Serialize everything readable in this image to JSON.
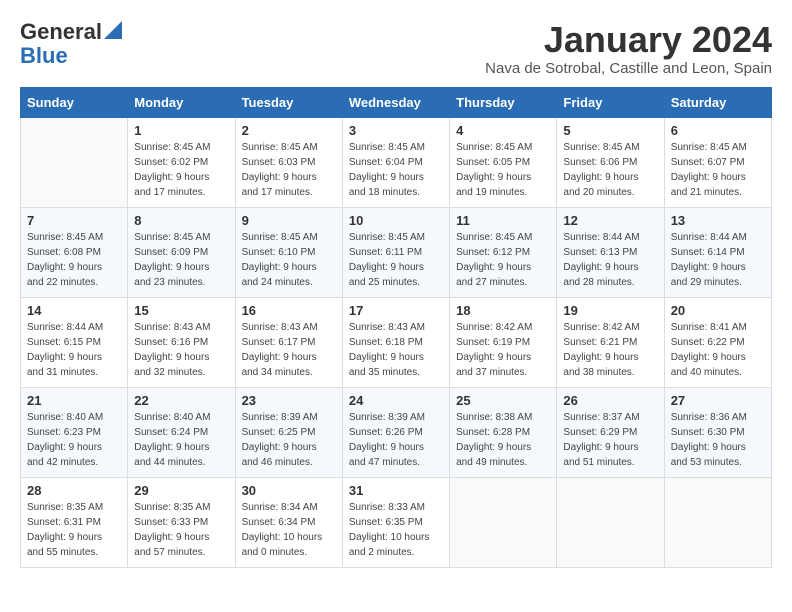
{
  "logo": {
    "general": "General",
    "blue": "Blue"
  },
  "title": "January 2024",
  "subtitle": "Nava de Sotrobal, Castille and Leon, Spain",
  "days_header": [
    "Sunday",
    "Monday",
    "Tuesday",
    "Wednesday",
    "Thursday",
    "Friday",
    "Saturday"
  ],
  "weeks": [
    [
      {
        "day": "",
        "sunrise": "",
        "sunset": "",
        "daylight": ""
      },
      {
        "day": "1",
        "sunrise": "Sunrise: 8:45 AM",
        "sunset": "Sunset: 6:02 PM",
        "daylight": "Daylight: 9 hours and 17 minutes."
      },
      {
        "day": "2",
        "sunrise": "Sunrise: 8:45 AM",
        "sunset": "Sunset: 6:03 PM",
        "daylight": "Daylight: 9 hours and 17 minutes."
      },
      {
        "day": "3",
        "sunrise": "Sunrise: 8:45 AM",
        "sunset": "Sunset: 6:04 PM",
        "daylight": "Daylight: 9 hours and 18 minutes."
      },
      {
        "day": "4",
        "sunrise": "Sunrise: 8:45 AM",
        "sunset": "Sunset: 6:05 PM",
        "daylight": "Daylight: 9 hours and 19 minutes."
      },
      {
        "day": "5",
        "sunrise": "Sunrise: 8:45 AM",
        "sunset": "Sunset: 6:06 PM",
        "daylight": "Daylight: 9 hours and 20 minutes."
      },
      {
        "day": "6",
        "sunrise": "Sunrise: 8:45 AM",
        "sunset": "Sunset: 6:07 PM",
        "daylight": "Daylight: 9 hours and 21 minutes."
      }
    ],
    [
      {
        "day": "7",
        "sunrise": "Sunrise: 8:45 AM",
        "sunset": "Sunset: 6:08 PM",
        "daylight": "Daylight: 9 hours and 22 minutes."
      },
      {
        "day": "8",
        "sunrise": "Sunrise: 8:45 AM",
        "sunset": "Sunset: 6:09 PM",
        "daylight": "Daylight: 9 hours and 23 minutes."
      },
      {
        "day": "9",
        "sunrise": "Sunrise: 8:45 AM",
        "sunset": "Sunset: 6:10 PM",
        "daylight": "Daylight: 9 hours and 24 minutes."
      },
      {
        "day": "10",
        "sunrise": "Sunrise: 8:45 AM",
        "sunset": "Sunset: 6:11 PM",
        "daylight": "Daylight: 9 hours and 25 minutes."
      },
      {
        "day": "11",
        "sunrise": "Sunrise: 8:45 AM",
        "sunset": "Sunset: 6:12 PM",
        "daylight": "Daylight: 9 hours and 27 minutes."
      },
      {
        "day": "12",
        "sunrise": "Sunrise: 8:44 AM",
        "sunset": "Sunset: 6:13 PM",
        "daylight": "Daylight: 9 hours and 28 minutes."
      },
      {
        "day": "13",
        "sunrise": "Sunrise: 8:44 AM",
        "sunset": "Sunset: 6:14 PM",
        "daylight": "Daylight: 9 hours and 29 minutes."
      }
    ],
    [
      {
        "day": "14",
        "sunrise": "Sunrise: 8:44 AM",
        "sunset": "Sunset: 6:15 PM",
        "daylight": "Daylight: 9 hours and 31 minutes."
      },
      {
        "day": "15",
        "sunrise": "Sunrise: 8:43 AM",
        "sunset": "Sunset: 6:16 PM",
        "daylight": "Daylight: 9 hours and 32 minutes."
      },
      {
        "day": "16",
        "sunrise": "Sunrise: 8:43 AM",
        "sunset": "Sunset: 6:17 PM",
        "daylight": "Daylight: 9 hours and 34 minutes."
      },
      {
        "day": "17",
        "sunrise": "Sunrise: 8:43 AM",
        "sunset": "Sunset: 6:18 PM",
        "daylight": "Daylight: 9 hours and 35 minutes."
      },
      {
        "day": "18",
        "sunrise": "Sunrise: 8:42 AM",
        "sunset": "Sunset: 6:19 PM",
        "daylight": "Daylight: 9 hours and 37 minutes."
      },
      {
        "day": "19",
        "sunrise": "Sunrise: 8:42 AM",
        "sunset": "Sunset: 6:21 PM",
        "daylight": "Daylight: 9 hours and 38 minutes."
      },
      {
        "day": "20",
        "sunrise": "Sunrise: 8:41 AM",
        "sunset": "Sunset: 6:22 PM",
        "daylight": "Daylight: 9 hours and 40 minutes."
      }
    ],
    [
      {
        "day": "21",
        "sunrise": "Sunrise: 8:40 AM",
        "sunset": "Sunset: 6:23 PM",
        "daylight": "Daylight: 9 hours and 42 minutes."
      },
      {
        "day": "22",
        "sunrise": "Sunrise: 8:40 AM",
        "sunset": "Sunset: 6:24 PM",
        "daylight": "Daylight: 9 hours and 44 minutes."
      },
      {
        "day": "23",
        "sunrise": "Sunrise: 8:39 AM",
        "sunset": "Sunset: 6:25 PM",
        "daylight": "Daylight: 9 hours and 46 minutes."
      },
      {
        "day": "24",
        "sunrise": "Sunrise: 8:39 AM",
        "sunset": "Sunset: 6:26 PM",
        "daylight": "Daylight: 9 hours and 47 minutes."
      },
      {
        "day": "25",
        "sunrise": "Sunrise: 8:38 AM",
        "sunset": "Sunset: 6:28 PM",
        "daylight": "Daylight: 9 hours and 49 minutes."
      },
      {
        "day": "26",
        "sunrise": "Sunrise: 8:37 AM",
        "sunset": "Sunset: 6:29 PM",
        "daylight": "Daylight: 9 hours and 51 minutes."
      },
      {
        "day": "27",
        "sunrise": "Sunrise: 8:36 AM",
        "sunset": "Sunset: 6:30 PM",
        "daylight": "Daylight: 9 hours and 53 minutes."
      }
    ],
    [
      {
        "day": "28",
        "sunrise": "Sunrise: 8:35 AM",
        "sunset": "Sunset: 6:31 PM",
        "daylight": "Daylight: 9 hours and 55 minutes."
      },
      {
        "day": "29",
        "sunrise": "Sunrise: 8:35 AM",
        "sunset": "Sunset: 6:33 PM",
        "daylight": "Daylight: 9 hours and 57 minutes."
      },
      {
        "day": "30",
        "sunrise": "Sunrise: 8:34 AM",
        "sunset": "Sunset: 6:34 PM",
        "daylight": "Daylight: 10 hours and 0 minutes."
      },
      {
        "day": "31",
        "sunrise": "Sunrise: 8:33 AM",
        "sunset": "Sunset: 6:35 PM",
        "daylight": "Daylight: 10 hours and 2 minutes."
      },
      {
        "day": "",
        "sunrise": "",
        "sunset": "",
        "daylight": ""
      },
      {
        "day": "",
        "sunrise": "",
        "sunset": "",
        "daylight": ""
      },
      {
        "day": "",
        "sunrise": "",
        "sunset": "",
        "daylight": ""
      }
    ]
  ]
}
